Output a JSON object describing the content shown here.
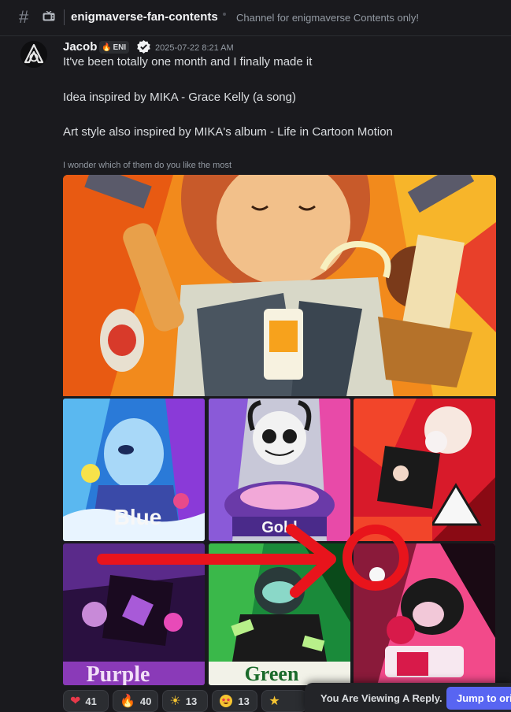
{
  "header": {
    "channel_name": "enigmaverse-fan-contents",
    "channel_topic": "Channel for enigmaverse Contents only!"
  },
  "message": {
    "author": "Jacob",
    "role_tag": "ENI",
    "timestamp": "2025-07-22 8:21 AM",
    "lines": [
      "It've been totally one month and I finally made it",
      "Idea inspired by MIKA - Grace Kelly (a song)",
      "Art style also inspired by MIKA's album - Life in Cartoon Motion"
    ],
    "attachment_caption": "I wonder which of them do you like the most",
    "art_tiles": [
      {
        "theme": "orange",
        "lettering": ""
      },
      {
        "theme": "blue",
        "lettering": "Blue"
      },
      {
        "theme": "grey",
        "lettering": "Gold"
      },
      {
        "theme": "red",
        "lettering": ""
      },
      {
        "theme": "purple",
        "lettering": "Purple"
      },
      {
        "theme": "green",
        "lettering": "Green"
      },
      {
        "theme": "pink",
        "lettering": ""
      }
    ]
  },
  "reactions": [
    {
      "emoji": "heart-icon",
      "count": "41"
    },
    {
      "emoji": "fire-icon",
      "count": "40"
    },
    {
      "emoji": "sun-icon",
      "count": "13"
    },
    {
      "emoji": "star-struck-icon",
      "count": "13"
    },
    {
      "emoji": "star-icon",
      "count": ""
    }
  ],
  "reply_banner": {
    "text": "You Are Viewing A Reply.",
    "button_label": "Jump to original"
  },
  "colors": {
    "background": "#1a1a1e",
    "accent": "#5865f2",
    "annotation_red": "#e8141c"
  }
}
